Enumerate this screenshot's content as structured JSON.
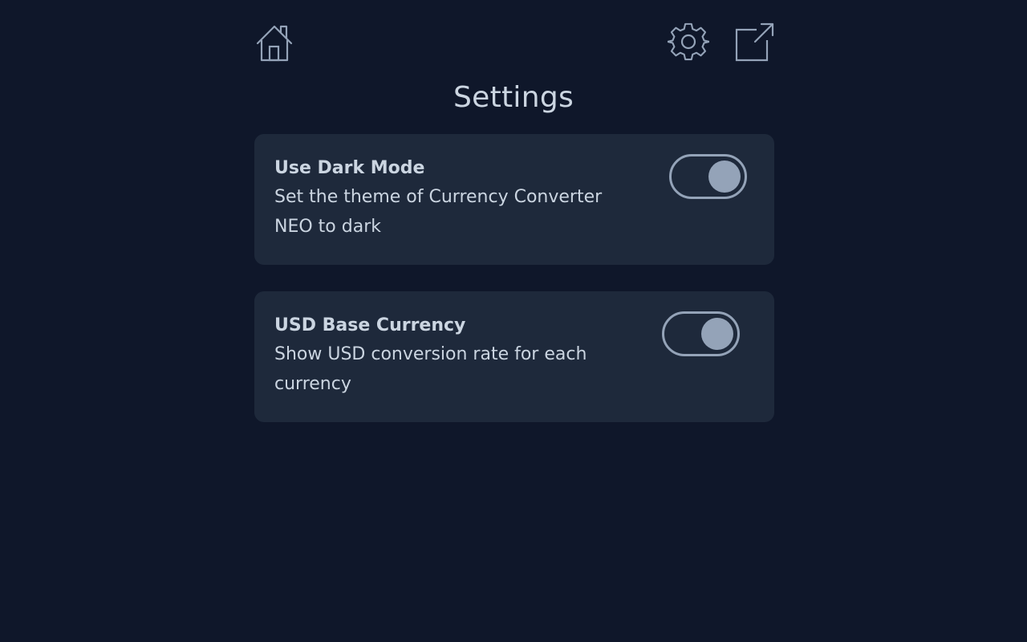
{
  "header": {
    "title": "Settings",
    "icons": [
      "house-icon",
      "gear-icon",
      "external-link-icon"
    ]
  },
  "settings": [
    {
      "title": "Use Dark Mode",
      "description": "Set the theme of Currency Converter NEO to dark",
      "enabled": true
    },
    {
      "title": "USD Base Currency",
      "description": "Show USD conversion rate for each currency",
      "enabled": true
    }
  ],
  "colors": {
    "background": "#0f172a",
    "card": "#1e293b",
    "text": "#cbd5e1",
    "accent": "#94a3b8"
  }
}
